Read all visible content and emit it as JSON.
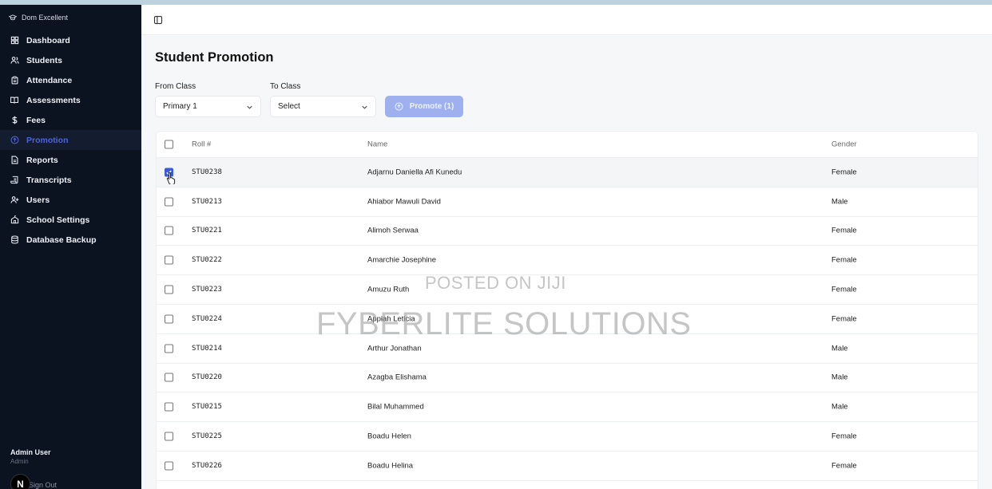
{
  "app": {
    "brand": "Dom Excellent"
  },
  "sidebar": {
    "items": [
      {
        "label": "Dashboard",
        "icon": "dashboard-icon"
      },
      {
        "label": "Students",
        "icon": "users-icon"
      },
      {
        "label": "Attendance",
        "icon": "clipboard-icon"
      },
      {
        "label": "Assessments",
        "icon": "book-icon"
      },
      {
        "label": "Fees",
        "icon": "dollar-icon"
      },
      {
        "label": "Promotion",
        "icon": "circle-up-icon",
        "active": true
      },
      {
        "label": "Reports",
        "icon": "file-icon"
      },
      {
        "label": "Transcripts",
        "icon": "scroll-icon"
      },
      {
        "label": "Users",
        "icon": "user-plus-icon"
      },
      {
        "label": "School Settings",
        "icon": "school-icon"
      },
      {
        "label": "Database Backup",
        "icon": "database-icon"
      }
    ],
    "user": {
      "name": "Admin User",
      "role": "Admin",
      "signout": "Sign Out"
    },
    "badge": "N"
  },
  "page": {
    "title": "Student Promotion",
    "from_label": "From Class",
    "from_value": "Primary 1",
    "to_label": "To Class",
    "to_value": "Select",
    "promote_label": "Promote (1)"
  },
  "table": {
    "headers": {
      "roll": "Roll #",
      "name": "Name",
      "gender": "Gender"
    },
    "rows": [
      {
        "roll": "STU0238",
        "name": "Adjarnu Daniella Afi Kunedu",
        "gender": "Female",
        "checked": true
      },
      {
        "roll": "STU0213",
        "name": "Ahiabor Mawuli David",
        "gender": "Male",
        "checked": false
      },
      {
        "roll": "STU0221",
        "name": "Alimoh Serwaa",
        "gender": "Female",
        "checked": false
      },
      {
        "roll": "STU0222",
        "name": "Amarchie Josephine",
        "gender": "Female",
        "checked": false
      },
      {
        "roll": "STU0223",
        "name": "Amuzu Ruth",
        "gender": "Female",
        "checked": false
      },
      {
        "roll": "STU0224",
        "name": "Appiah Leticia",
        "gender": "Female",
        "checked": false
      },
      {
        "roll": "STU0214",
        "name": "Arthur Jonathan",
        "gender": "Male",
        "checked": false
      },
      {
        "roll": "STU0220",
        "name": "Azagba Elishama",
        "gender": "Male",
        "checked": false
      },
      {
        "roll": "STU0215",
        "name": "Bilal Muhammed",
        "gender": "Male",
        "checked": false
      },
      {
        "roll": "STU0225",
        "name": "Boadu Helen",
        "gender": "Female",
        "checked": false
      },
      {
        "roll": "STU0226",
        "name": "Boadu Helina",
        "gender": "Female",
        "checked": false
      }
    ]
  },
  "watermark": {
    "line1": "POSTED ON JIJI",
    "line2": "FYBERLITE SOLUTIONS"
  },
  "colors": {
    "sidebar_bg": "#0b1220",
    "accent": "#4f63d8",
    "promote_bg": "#9eb0ee",
    "checkbox_on": "#3b5bd6"
  }
}
